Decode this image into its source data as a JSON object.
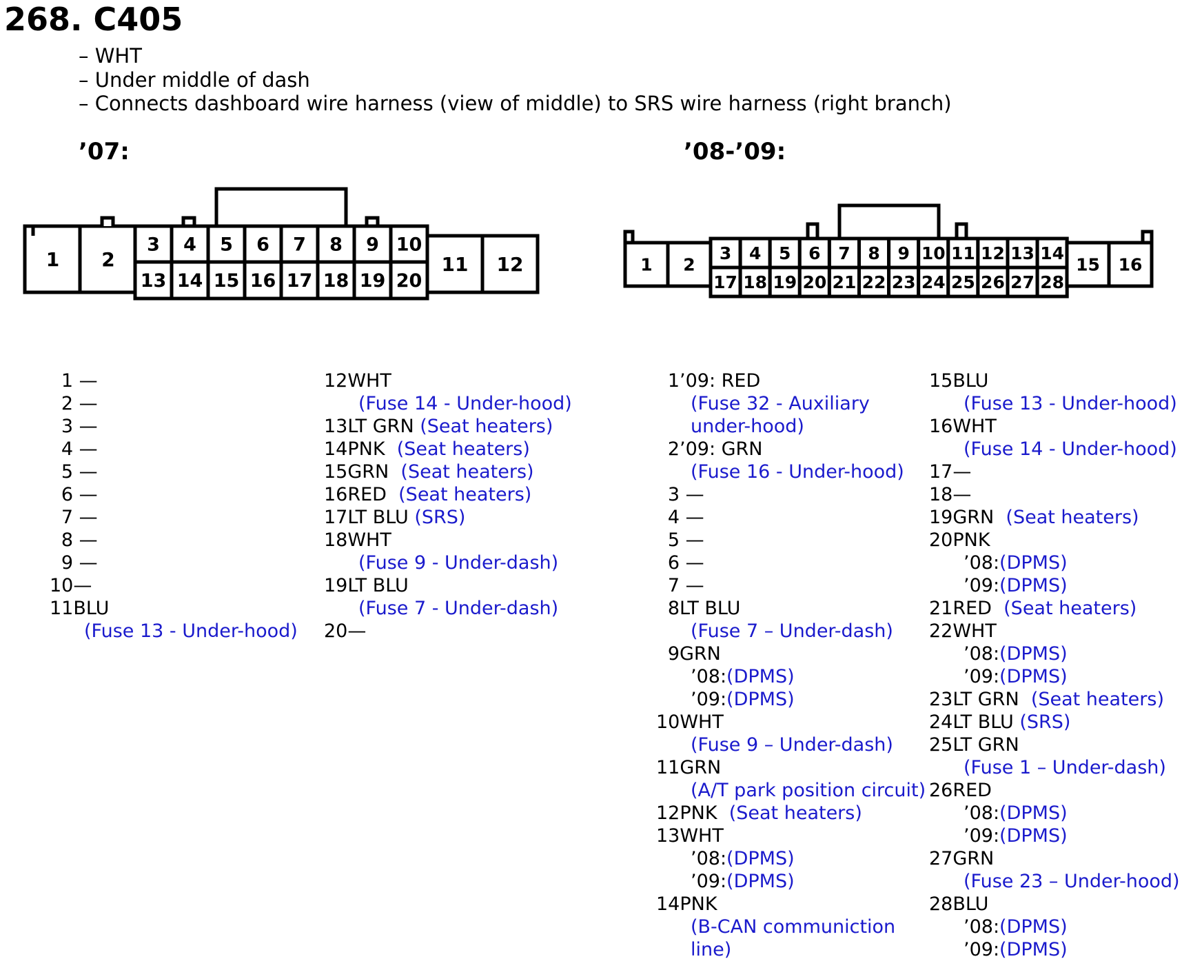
{
  "title": "268. C405",
  "notes": [
    "– WHT",
    "– Under middle of dash",
    "– Connects dashboard wire harness (view of middle) to SRS wire harness (right branch)"
  ],
  "sections": {
    "left_label": "’07:",
    "right_label": "’08-’09:"
  },
  "connector_07": {
    "pins": [
      "1",
      "2",
      "3",
      "4",
      "5",
      "6",
      "7",
      "8",
      "9",
      "10",
      "11",
      "12",
      "13",
      "14",
      "15",
      "16",
      "17",
      "18",
      "19",
      "20"
    ]
  },
  "connector_0809": {
    "pins": [
      "1",
      "2",
      "3",
      "4",
      "5",
      "6",
      "7",
      "8",
      "9",
      "10",
      "11",
      "12",
      "13",
      "14",
      "15",
      "16",
      "17",
      "18",
      "19",
      "20",
      "21",
      "22",
      "23",
      "24",
      "25",
      "26",
      "27",
      "28"
    ]
  },
  "colors": {
    "text": "#000000",
    "circuit_note": "#1a1acc"
  },
  "pins_07_col1": [
    {
      "n": "1",
      "wire": " —",
      "lines": []
    },
    {
      "n": "2",
      "wire": " —",
      "lines": []
    },
    {
      "n": "3",
      "wire": " —",
      "lines": []
    },
    {
      "n": "4",
      "wire": " —",
      "lines": []
    },
    {
      "n": "5",
      "wire": " —",
      "lines": []
    },
    {
      "n": "6",
      "wire": " —",
      "lines": []
    },
    {
      "n": "7",
      "wire": " —",
      "lines": []
    },
    {
      "n": "8",
      "wire": " —",
      "lines": []
    },
    {
      "n": "9",
      "wire": " —",
      "lines": []
    },
    {
      "n": "10",
      "wire": "—",
      "lines": []
    },
    {
      "n": "11",
      "wire": "BLU",
      "lines": [
        {
          "pre": "",
          "blue": "(Fuse 13 - Under-hood)"
        }
      ]
    }
  ],
  "pins_07_col2": [
    {
      "n": "12",
      "wire": "WHT",
      "lines": [
        {
          "pre": "",
          "blue": "(Fuse 14 - Under-hood)"
        }
      ]
    },
    {
      "n": "13",
      "wire": "LT GRN ",
      "inline": "(Seat heaters)",
      "lines": []
    },
    {
      "n": "14",
      "wire": "PNK  ",
      "inline": "(Seat heaters)",
      "lines": []
    },
    {
      "n": "15",
      "wire": "GRN  ",
      "inline": "(Seat heaters)",
      "lines": []
    },
    {
      "n": "16",
      "wire": "RED  ",
      "inline": "(Seat heaters)",
      "lines": []
    },
    {
      "n": "17",
      "wire": "LT BLU ",
      "inline": "(SRS)",
      "lines": []
    },
    {
      "n": "18",
      "wire": "WHT",
      "lines": [
        {
          "pre": "",
          "blue": "(Fuse 9 - Under-dash)"
        }
      ]
    },
    {
      "n": "19",
      "wire": "LT BLU",
      "lines": [
        {
          "pre": "",
          "blue": "(Fuse 7 - Under-dash)"
        }
      ]
    },
    {
      "n": "20",
      "wire": "—",
      "lines": []
    }
  ],
  "pins_0809_col1": [
    {
      "n": "1",
      "wire": "’09: RED",
      "lines": [
        {
          "pre": "",
          "blue": "(Fuse 32 - Auxiliary"
        },
        {
          "pre": "",
          "blue": "under-hood)"
        }
      ]
    },
    {
      "n": "2",
      "wire": "’09: GRN",
      "lines": [
        {
          "pre": "",
          "blue": "(Fuse 16 - Under-hood)"
        }
      ]
    },
    {
      "n": "3",
      "wire": " —",
      "lines": []
    },
    {
      "n": "4",
      "wire": " —",
      "lines": []
    },
    {
      "n": "5",
      "wire": " —",
      "lines": []
    },
    {
      "n": "6",
      "wire": " —",
      "lines": []
    },
    {
      "n": "7",
      "wire": " —",
      "lines": []
    },
    {
      "n": "8",
      "wire": "LT BLU",
      "lines": [
        {
          "pre": "",
          "blue": "(Fuse 7 – Under-dash)"
        }
      ]
    },
    {
      "n": "9",
      "wire": "GRN",
      "lines": [
        {
          "pre": "’08:",
          "blue": "(DPMS)"
        },
        {
          "pre": "’09:",
          "blue": "(DPMS)"
        }
      ]
    },
    {
      "n": "10",
      "wire": "WHT",
      "lines": [
        {
          "pre": "",
          "blue": "(Fuse 9 – Under-dash)"
        }
      ]
    },
    {
      "n": "11",
      "wire": "GRN",
      "lines": [
        {
          "pre": "",
          "blue": "(A/T park position circuit)"
        }
      ]
    },
    {
      "n": "12",
      "wire": "PNK  ",
      "inline": "(Seat heaters)",
      "lines": []
    },
    {
      "n": "13",
      "wire": "WHT",
      "lines": [
        {
          "pre": "’08:",
          "blue": "(DPMS)"
        },
        {
          "pre": "’09:",
          "blue": "(DPMS)"
        }
      ]
    },
    {
      "n": "14",
      "wire": "PNK",
      "lines": [
        {
          "pre": "",
          "blue": "(B-CAN communiction"
        },
        {
          "pre": "",
          "blue": "line)"
        }
      ]
    }
  ],
  "pins_0809_col2": [
    {
      "n": "15",
      "wire": "BLU",
      "lines": [
        {
          "pre": "",
          "blue": "(Fuse 13 - Under-hood)"
        }
      ]
    },
    {
      "n": "16",
      "wire": "WHT",
      "lines": [
        {
          "pre": "",
          "blue": "(Fuse 14 - Under-hood)"
        }
      ]
    },
    {
      "n": "17",
      "wire": "—",
      "lines": []
    },
    {
      "n": "18",
      "wire": "—",
      "lines": []
    },
    {
      "n": "19",
      "wire": "GRN  ",
      "inline": "(Seat heaters)",
      "lines": []
    },
    {
      "n": "20",
      "wire": "PNK",
      "lines": [
        {
          "pre": "’08:",
          "blue": "(DPMS)"
        },
        {
          "pre": "’09:",
          "blue": "(DPMS)"
        }
      ]
    },
    {
      "n": "21",
      "wire": "RED  ",
      "inline": "(Seat heaters)",
      "lines": []
    },
    {
      "n": "22",
      "wire": "WHT",
      "lines": [
        {
          "pre": "’08:",
          "blue": "(DPMS)"
        },
        {
          "pre": "’09:",
          "blue": "(DPMS)"
        }
      ]
    },
    {
      "n": "23",
      "wire": "LT GRN  ",
      "inline": "(Seat heaters)",
      "lines": []
    },
    {
      "n": "24",
      "wire": "LT BLU ",
      "inline": "(SRS)",
      "lines": []
    },
    {
      "n": "25",
      "wire": "LT GRN",
      "lines": [
        {
          "pre": "",
          "blue": "(Fuse 1 – Under-dash)"
        }
      ]
    },
    {
      "n": "26",
      "wire": "RED",
      "lines": [
        {
          "pre": "’08:",
          "blue": "(DPMS)"
        },
        {
          "pre": "’09:",
          "blue": "(DPMS)"
        }
      ]
    },
    {
      "n": "27",
      "wire": "GRN",
      "lines": [
        {
          "pre": "",
          "blue": "(Fuse 23 – Under-hood)"
        }
      ]
    },
    {
      "n": "28",
      "wire": "BLU",
      "lines": [
        {
          "pre": "’08:",
          "blue": "(DPMS)"
        },
        {
          "pre": "’09:",
          "blue": "(DPMS)"
        }
      ]
    }
  ]
}
